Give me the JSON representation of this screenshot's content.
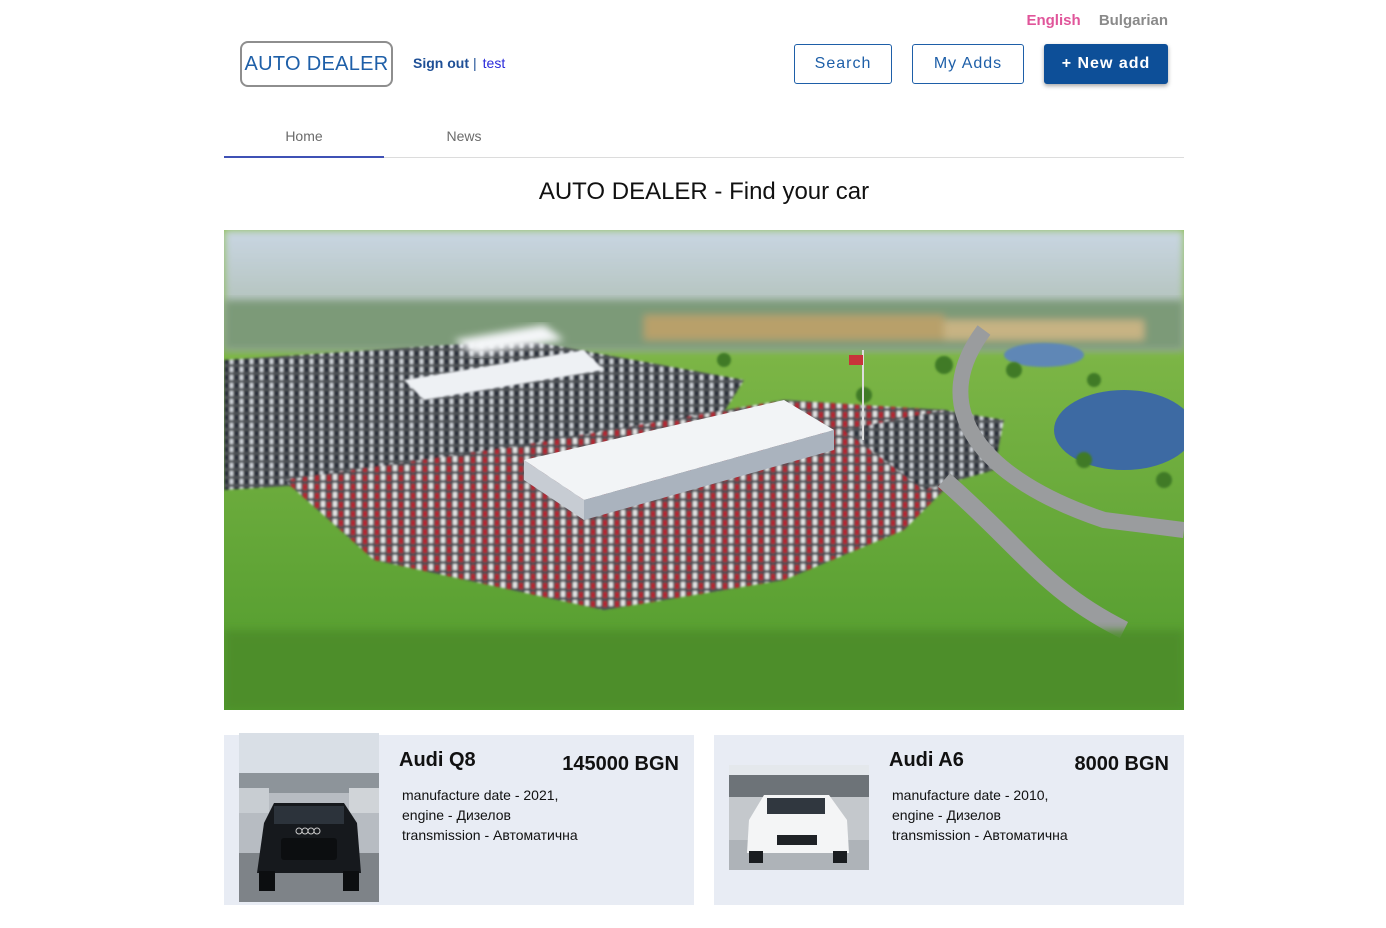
{
  "languages": {
    "english": "English",
    "bulgarian": "Bulgarian"
  },
  "header": {
    "logo": "AUTO DEALER",
    "sign_out": "Sign out",
    "separator": "|",
    "username": "test",
    "search_label": "Search",
    "my_adds_label": "My Adds",
    "new_add_label": "+ New add"
  },
  "tabs": [
    {
      "label": "Home",
      "active": true
    },
    {
      "label": "News",
      "active": false
    }
  ],
  "headline": "AUTO DEALER - Find your car",
  "listings": [
    {
      "title": "Audi Q8",
      "price": "145000 BGN",
      "details": [
        "manufacture date - 2021,",
        "engine - Дизелов",
        "transmission - Автоматична"
      ]
    },
    {
      "title": "Audi A6",
      "price": "8000 BGN",
      "details": [
        "manufacture date - 2010,",
        "engine - Дизелов",
        "transmission - Автоматична"
      ]
    }
  ],
  "colors": {
    "brand": "#1e5fa8",
    "primary_button": "#0d4f98",
    "active_language": "#e0559a",
    "tab_indicator": "#3f51b5",
    "card_background": "#e8ecf4"
  }
}
